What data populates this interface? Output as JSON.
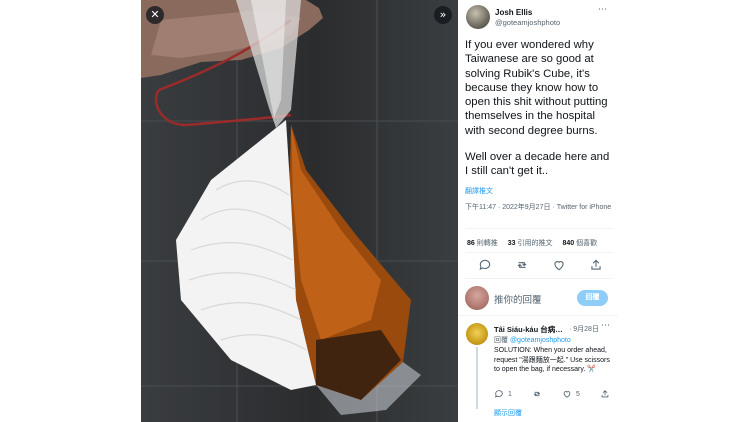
{
  "media": {
    "close_glyph": "✕",
    "expand_glyph": "»"
  },
  "tweet": {
    "author_name": "Josh Ellis",
    "author_handle": "@goteamjoshphoto",
    "more_glyph": "⋯",
    "text_p1": "If you ever wondered why Taiwanese are so good at solving Rubik's Cube, it's because they know how to open this shit without putting themselves in the hospital with second degree burns.",
    "text_p2": "Well over a decade here and I still can't get it..",
    "translate_label": "翻譯推文",
    "timestamp": "下午11:47 · 2022年9月27日 · Twitter for iPhone",
    "retweets_count": "86",
    "retweets_label": "則轉推",
    "quotes_count": "33",
    "quotes_label": "引用的推文",
    "likes_count": "840",
    "likes_label": "個喜歡"
  },
  "compose": {
    "placeholder": "推你的回覆",
    "button_label": "回覆"
  },
  "reply": {
    "author_name": "Tâi Siáu-káu 台病…",
    "date": "· 9月28日",
    "more_glyph": "⋯",
    "reply_to_label": "回覆",
    "reply_to_handle": "@goteamjoshphoto",
    "text": "SOLUTION: When you order ahead, request \"湯跟麵放一起.\" Use scissors to open the bag, if necessary. ✂️",
    "reply_count": "1",
    "like_count": "5",
    "show_replies_label": "顯示回覆"
  },
  "colors": {
    "accent": "#1d9bf0",
    "secondary_text": "#536471",
    "reply_button": "#8ecdf8"
  }
}
